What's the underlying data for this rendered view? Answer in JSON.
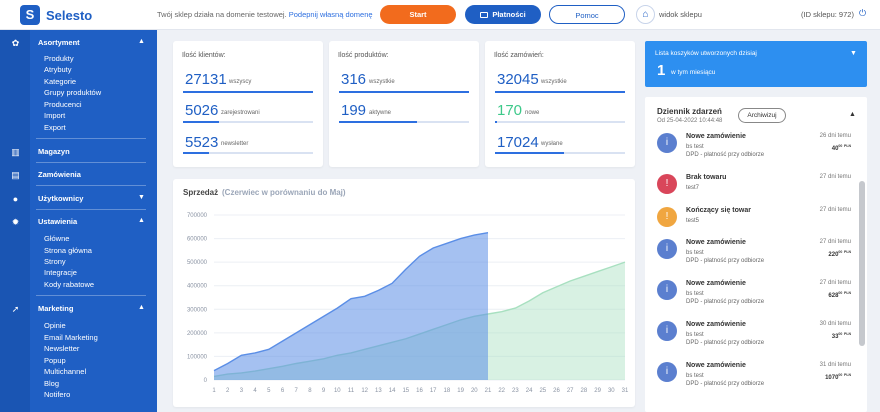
{
  "topbar": {
    "logo": "Selesto",
    "message": "Twój sklep działa na domenie testowej.",
    "message_link": "Podepnij własną domenę",
    "start_label": "Start",
    "payments_label": "Płatności",
    "help_label": "Pomoc",
    "store_view_label": "widok sklepu",
    "shop_id": "(ID sklepu: 972)"
  },
  "sidebar": {
    "sections": [
      {
        "label": "Asortyment",
        "items": [
          "Produkty",
          "Atrybuty",
          "Kategorie",
          "Grupy produktów",
          "Producenci",
          "Import",
          "Export"
        ]
      },
      {
        "label": "Magazyn"
      },
      {
        "label": "Zamówienia"
      },
      {
        "label": "Użytkownicy"
      },
      {
        "label": "Ustawienia",
        "items": [
          "Główne",
          "Strona główna",
          "Strony",
          "Integracje",
          "Kody rabatowe"
        ]
      },
      {
        "label": "Marketing",
        "items": [
          "Opinie",
          "Email Marketing",
          "Newsletter",
          "Popup",
          "Multichannel",
          "Blog",
          "Notifero"
        ]
      }
    ]
  },
  "stats": {
    "clients": {
      "title": "Ilość klientów:",
      "rows": [
        {
          "value": "27131",
          "label": "wszyscy",
          "fill": 1.0
        },
        {
          "value": "5026",
          "label": "zarejestrowani",
          "fill": 0.28
        },
        {
          "value": "5523",
          "label": "newsletter",
          "fill": 0.2
        }
      ]
    },
    "products": {
      "title": "Ilość produktów:",
      "rows": [
        {
          "value": "316",
          "label": "wszystkie",
          "fill": 1.0
        },
        {
          "value": "199",
          "label": "aktywne",
          "fill": 0.6
        }
      ]
    },
    "orders": {
      "title": "Ilość zamówień:",
      "rows": [
        {
          "value": "32045",
          "label": "wszystkie",
          "fill": 1.0
        },
        {
          "value": "170",
          "label": "nowe",
          "fill": 0.01
        },
        {
          "value": "17024",
          "label": "wysłane",
          "fill": 0.53
        }
      ]
    }
  },
  "sales": {
    "title": "Sprzedaż",
    "subtitle": "(Czerwiec w porównaniu do Maj)"
  },
  "chart_data": {
    "type": "area",
    "title": "Sprzedaż",
    "subtitle": "(Czerwiec w porównaniu do Maj)",
    "ylim": [
      0,
      700000
    ],
    "yticks": [
      "0",
      "100000",
      "200000",
      "300000",
      "400000",
      "500000",
      "600000",
      "700000"
    ],
    "x": [
      1,
      2,
      3,
      4,
      5,
      6,
      7,
      8,
      9,
      10,
      11,
      12,
      13,
      14,
      15,
      16,
      17,
      18,
      19,
      20,
      21,
      22,
      23,
      24,
      25,
      26,
      27,
      28,
      29,
      30,
      31
    ],
    "series": [
      {
        "color": "#5b8ee6",
        "values": [
          40000,
          70000,
          105000,
          115000,
          130000,
          165000,
          200000,
          235000,
          270000,
          305000,
          345000,
          355000,
          380000,
          410000,
          470000,
          525000,
          560000,
          580000,
          600000,
          615000,
          625000
        ]
      },
      {
        "color": "#a8e0c0",
        "values": [
          15000,
          25000,
          30000,
          38000,
          48000,
          58000,
          70000,
          80000,
          90000,
          105000,
          115000,
          130000,
          145000,
          160000,
          175000,
          195000,
          215000,
          235000,
          255000,
          270000,
          280000,
          290000,
          305000,
          335000,
          370000,
          395000,
          420000,
          440000,
          460000,
          480000,
          500000
        ]
      }
    ]
  },
  "carts": {
    "title": "Lista koszyków utworzonych dzisiaj",
    "count": "1",
    "label": "w tym miesiącu"
  },
  "events_log": {
    "title": "Dziennik zdarzeń",
    "date": "Od 25-04-2022 10:44:48",
    "archive_label": "Archiwizuj",
    "events": [
      {
        "type": "order",
        "color": "#5b7fcf",
        "title": "Nowe zamówienie",
        "line1": "bs test",
        "line2": "DPD - płatność przy odbiorze",
        "date": "26 dni temu",
        "price": "40",
        "price_sup": "00",
        "currency": "PLN"
      },
      {
        "type": "stock",
        "color": "#d9465a",
        "title": "Brak towaru",
        "line1": "test7",
        "line2": "",
        "date": "27 dni temu",
        "price": "",
        "price_sup": "",
        "currency": ""
      },
      {
        "type": "warning",
        "color": "#f0a640",
        "title": "Kończący się towar",
        "line1": "test5",
        "line2": "",
        "date": "27 dni temu",
        "price": "",
        "price_sup": "",
        "currency": ""
      },
      {
        "type": "order",
        "color": "#5b7fcf",
        "title": "Nowe zamówienie",
        "line1": "bs test",
        "line2": "DPD - płatność przy odbiorze",
        "date": "27 dni temu",
        "price": "220",
        "price_sup": "00",
        "currency": "PLN"
      },
      {
        "type": "order",
        "color": "#5b7fcf",
        "title": "Nowe zamówienie",
        "line1": "bs test",
        "line2": "DPD - płatność przy odbiorze",
        "date": "27 dni temu",
        "price": "628",
        "price_sup": "00",
        "currency": "PLN"
      },
      {
        "type": "order",
        "color": "#5b7fcf",
        "title": "Nowe zamówienie",
        "line1": "bs test",
        "line2": "DPD - płatność przy odbiorze",
        "date": "30 dni temu",
        "price": "33",
        "price_sup": "00",
        "currency": "PLN"
      },
      {
        "type": "order",
        "color": "#5b7fcf",
        "title": "Nowe zamówienie",
        "line1": "bs test",
        "line2": "DPD - płatność przy odbiorze",
        "date": "31 dni temu",
        "price": "1070",
        "price_sup": "00",
        "currency": "PLN"
      }
    ]
  }
}
